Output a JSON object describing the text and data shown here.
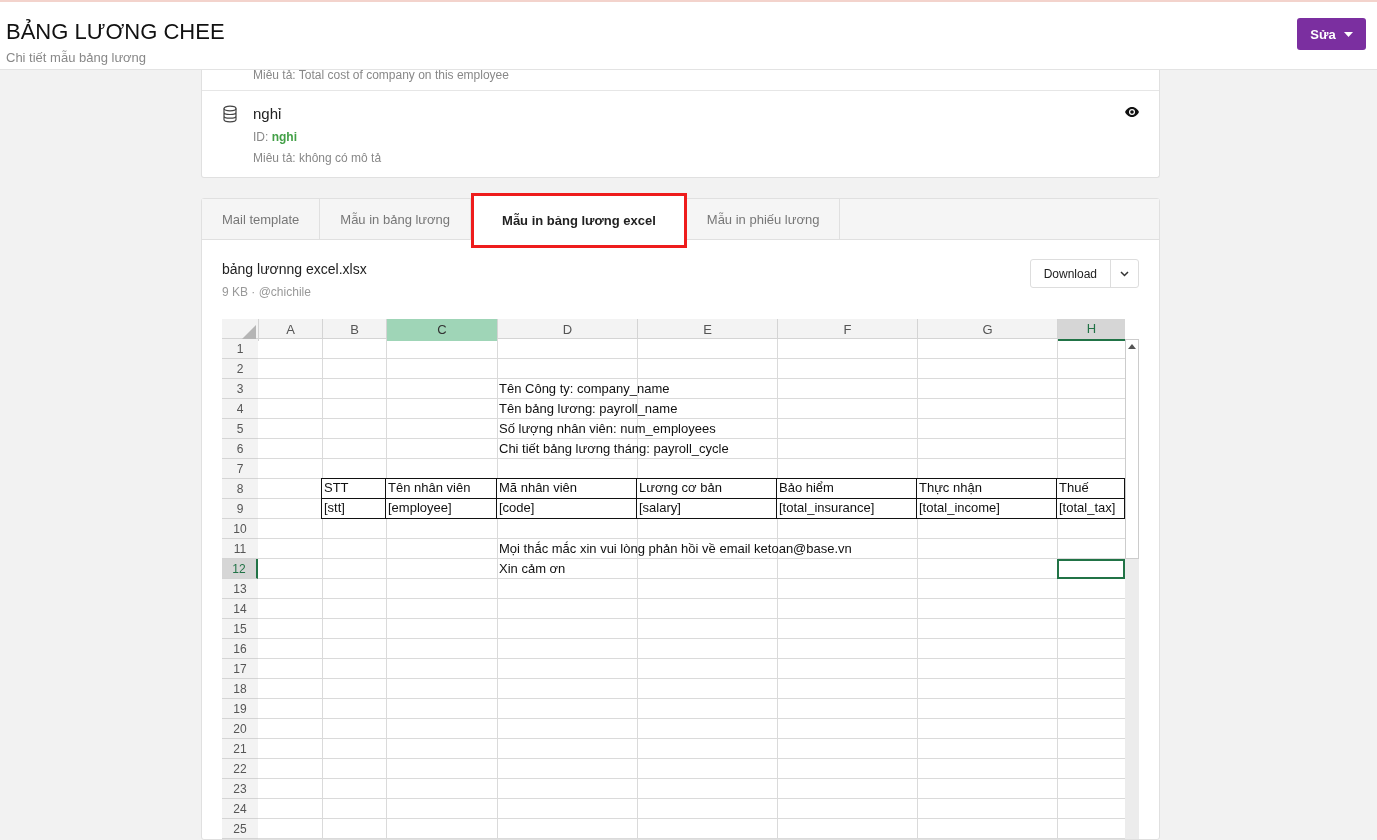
{
  "header": {
    "title": "BẢNG LƯƠNG CHEE",
    "subtitle": "Chi tiết mẫu bảng lương",
    "edit_button": "Sửa"
  },
  "fields": [
    {
      "kind": "partial",
      "description": "Miêu tả: Total cost of company on this employee"
    },
    {
      "kind": "full",
      "name": "nghỉ",
      "id_label": "ID:",
      "id": "nghi",
      "description": "Miêu tả: không có mô tả"
    }
  ],
  "tabs": [
    {
      "label": "Mail template",
      "selected": false
    },
    {
      "label": "Mẫu in bảng lương",
      "selected": false
    },
    {
      "label": "Mẫu in bảng lương excel",
      "selected": true
    },
    {
      "label": "Mẫu in phiếu lương",
      "selected": false
    }
  ],
  "file": {
    "name": "bảng lươnng excel.xlsx",
    "meta": "9 KB · @chichile",
    "download": "Download"
  },
  "sheet": {
    "columns": [
      {
        "label": "A",
        "highlighted": false,
        "selected": false
      },
      {
        "label": "B",
        "highlighted": false,
        "selected": false
      },
      {
        "label": "C",
        "highlighted": true,
        "selected": false
      },
      {
        "label": "D",
        "highlighted": false,
        "selected": false
      },
      {
        "label": "E",
        "highlighted": false,
        "selected": false
      },
      {
        "label": "F",
        "highlighted": false,
        "selected": false
      },
      {
        "label": "G",
        "highlighted": false,
        "selected": false
      },
      {
        "label": "H",
        "highlighted": false,
        "selected": true
      }
    ],
    "rows": [
      {
        "label": "1",
        "selected": false,
        "cells": [
          null,
          null,
          null,
          null,
          null,
          null,
          null,
          null
        ]
      },
      {
        "label": "2",
        "selected": false,
        "cells": [
          null,
          null,
          null,
          null,
          null,
          null,
          null,
          null
        ]
      },
      {
        "label": "3",
        "selected": false,
        "kind": "plain",
        "cells": [
          null,
          null,
          null,
          "Tên Công ty: company_name",
          null,
          null,
          null,
          null
        ]
      },
      {
        "label": "4",
        "selected": false,
        "kind": "plain",
        "cells": [
          null,
          null,
          null,
          "Tên bảng lương: payroll_name",
          null,
          null,
          null,
          null
        ]
      },
      {
        "label": "5",
        "selected": false,
        "kind": "plain",
        "cells": [
          null,
          null,
          null,
          "Số lượng nhân viên: num_employees",
          null,
          null,
          null,
          null
        ]
      },
      {
        "label": "6",
        "selected": false,
        "kind": "plain",
        "cells": [
          null,
          null,
          null,
          "Chi tiết bảng lương tháng: payroll_cycle",
          null,
          null,
          null,
          null
        ]
      },
      {
        "label": "7",
        "selected": false,
        "cells": [
          null,
          null,
          null,
          null,
          null,
          null,
          null,
          null
        ]
      },
      {
        "label": "8",
        "selected": false,
        "kind": "table",
        "cells": [
          null,
          "STT",
          "Tên nhân viên",
          "Mã nhân viên",
          "Lương cơ bản",
          "Bảo hiểm",
          "Thực nhận",
          "Thuế"
        ]
      },
      {
        "label": "9",
        "selected": false,
        "kind": "table",
        "cells": [
          null,
          "[stt]",
          "[employee]",
          "[code]",
          "[salary]",
          "[total_insurance]",
          "[total_income]",
          "[total_tax]"
        ]
      },
      {
        "label": "10",
        "selected": false,
        "cells": [
          null,
          null,
          null,
          null,
          null,
          null,
          null,
          null
        ]
      },
      {
        "label": "11",
        "selected": false,
        "kind": "plain",
        "cells": [
          null,
          null,
          null,
          "Mọi thắc mắc xin vui lòng phản hồi về email ketoan@base.vn",
          null,
          null,
          null,
          null
        ]
      },
      {
        "label": "12",
        "selected": true,
        "kind": "plain",
        "cells": [
          null,
          null,
          null,
          "Xin cảm ơn",
          null,
          null,
          null,
          null
        ]
      },
      {
        "label": "13",
        "selected": false,
        "cells": [
          null,
          null,
          null,
          null,
          null,
          null,
          null,
          null
        ]
      },
      {
        "label": "14",
        "selected": false,
        "cells": [
          null,
          null,
          null,
          null,
          null,
          null,
          null,
          null
        ]
      },
      {
        "label": "15",
        "selected": false,
        "cells": [
          null,
          null,
          null,
          null,
          null,
          null,
          null,
          null
        ]
      },
      {
        "label": "16",
        "selected": false,
        "cells": [
          null,
          null,
          null,
          null,
          null,
          null,
          null,
          null
        ]
      },
      {
        "label": "17",
        "selected": false,
        "cells": [
          null,
          null,
          null,
          null,
          null,
          null,
          null,
          null
        ]
      },
      {
        "label": "18",
        "selected": false,
        "cells": [
          null,
          null,
          null,
          null,
          null,
          null,
          null,
          null
        ]
      },
      {
        "label": "19",
        "selected": false,
        "cells": [
          null,
          null,
          null,
          null,
          null,
          null,
          null,
          null
        ]
      },
      {
        "label": "20",
        "selected": false,
        "cells": [
          null,
          null,
          null,
          null,
          null,
          null,
          null,
          null
        ]
      },
      {
        "label": "21",
        "selected": false,
        "cells": [
          null,
          null,
          null,
          null,
          null,
          null,
          null,
          null
        ]
      },
      {
        "label": "22",
        "selected": false,
        "cells": [
          null,
          null,
          null,
          null,
          null,
          null,
          null,
          null
        ]
      },
      {
        "label": "23",
        "selected": false,
        "cells": [
          null,
          null,
          null,
          null,
          null,
          null,
          null,
          null
        ]
      },
      {
        "label": "24",
        "selected": false,
        "cells": [
          null,
          null,
          null,
          null,
          null,
          null,
          null,
          null
        ]
      },
      {
        "label": "25",
        "selected": false,
        "cells": [
          null,
          null,
          null,
          null,
          null,
          null,
          null,
          null
        ]
      }
    ]
  }
}
